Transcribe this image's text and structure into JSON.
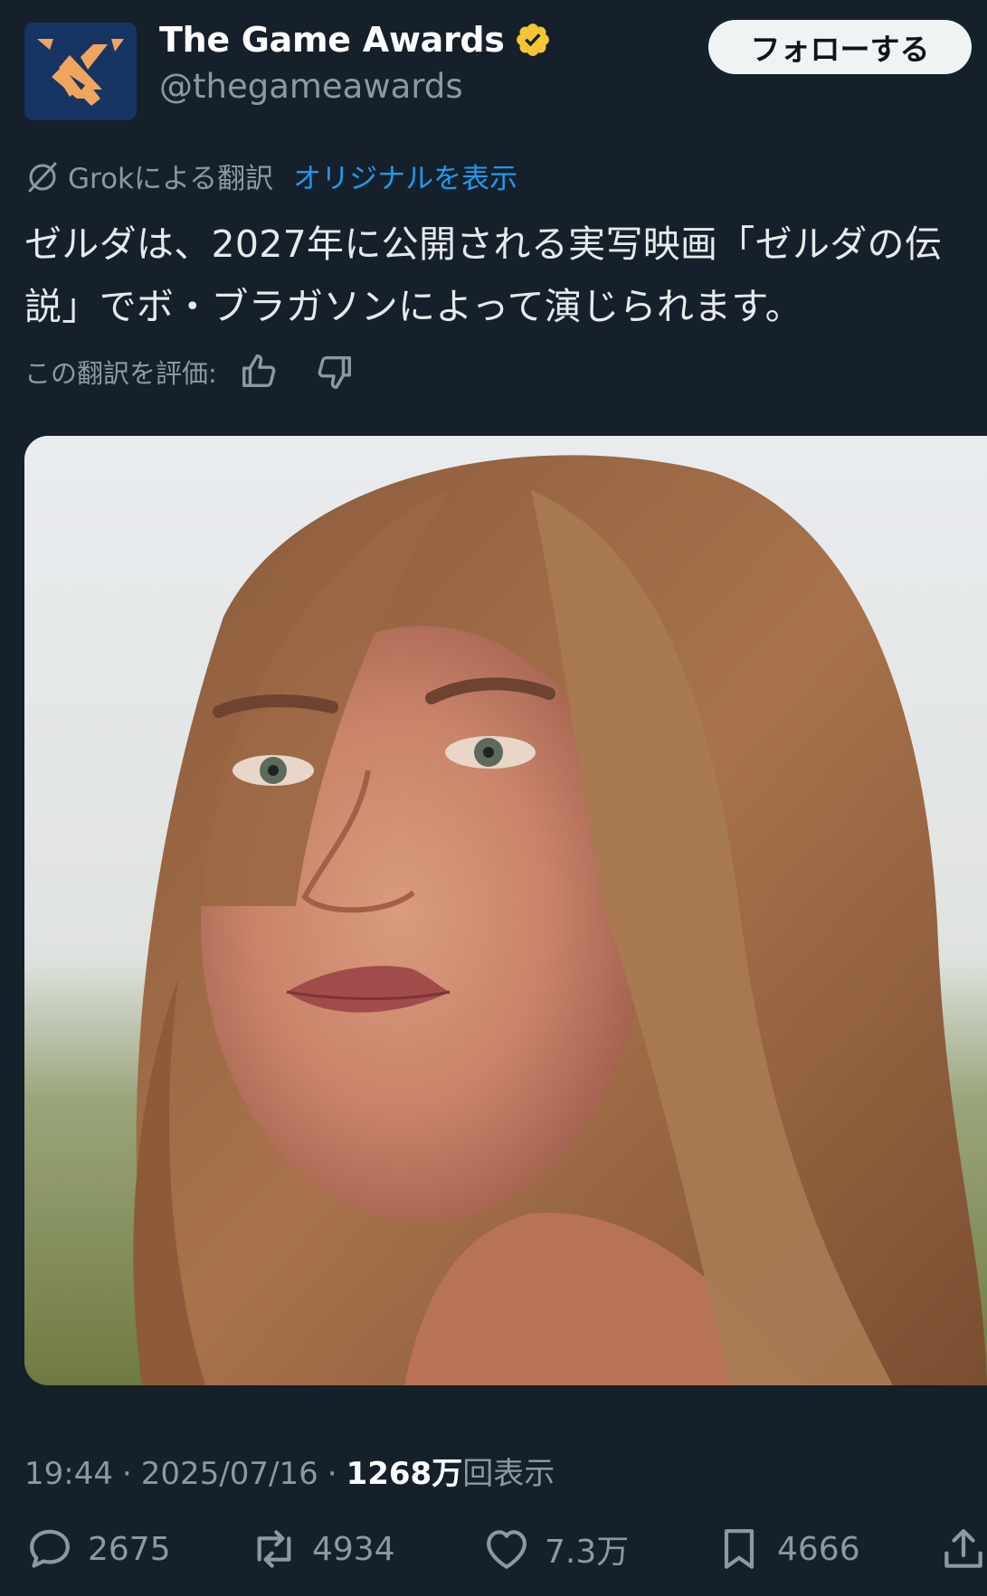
{
  "header": {
    "display_name": "The Game Awards",
    "handle": "@thegameawards",
    "follow_label": "フォローする"
  },
  "translation": {
    "translated_by": "Grokによる翻訳",
    "show_original": "オリジナルを表示",
    "rate_label": "この翻訳を評価:"
  },
  "tweet": {
    "text": "ゼルダは、2027年に公開される実写映画「ゼルダの伝説」でボ・ブラガソンによって演じられます。"
  },
  "meta": {
    "time": "19:44",
    "separator": "·",
    "date": "2025/07/16",
    "views_count": "1268万",
    "views_suffix": "回表示"
  },
  "actions": {
    "replies": "2675",
    "retweets": "4934",
    "likes": "7.3万",
    "bookmarks": "4666"
  },
  "colors": {
    "background": "#15202b",
    "accent": "#1d9bf0",
    "verified_badge": "#f4c534",
    "secondary_text": "#8b98a5"
  },
  "icons": {
    "avatar": "game-awards-logo",
    "verified": "verified-badge-icon",
    "grok": "grok-icon",
    "reply": "reply-icon",
    "retweet": "retweet-icon",
    "like": "heart-icon",
    "bookmark": "bookmark-icon",
    "share": "share-icon"
  }
}
